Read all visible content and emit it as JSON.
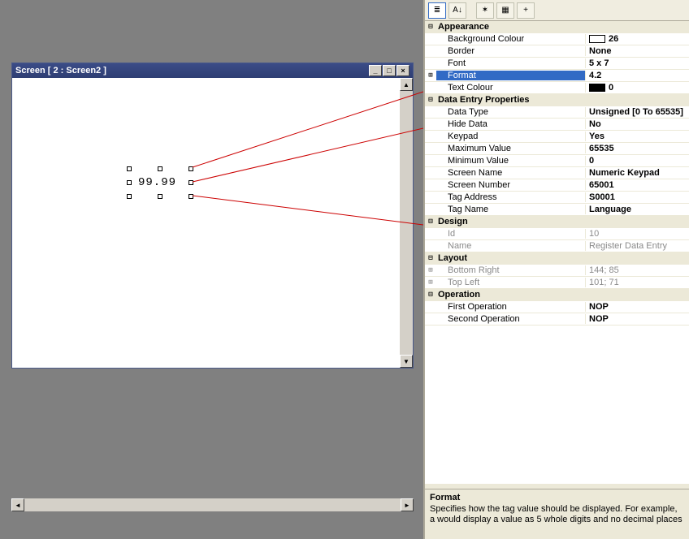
{
  "window": {
    "title": "Screen  [ 2 : Screen2 ]",
    "field_value": "99.99"
  },
  "toolbar": {
    "btn1": "≣",
    "btn2": "A↓",
    "btn3": "✶",
    "btn4": "▦",
    "btn5": "+"
  },
  "props": {
    "appearance": {
      "label": "Appearance",
      "bg_colour_label": "Background Colour",
      "bg_colour_value": "26",
      "border_label": "Border",
      "border_value": "None",
      "font_label": "Font",
      "font_value": "5 x 7",
      "format_label": "Format",
      "format_value": "4.2",
      "text_colour_label": "Text Colour",
      "text_colour_value": "0"
    },
    "data_entry": {
      "label": "Data Entry Properties",
      "data_type_label": "Data Type",
      "data_type_value": "Unsigned [0 To 65535]",
      "hide_data_label": "Hide Data",
      "hide_data_value": "No",
      "keypad_label": "Keypad",
      "keypad_value": "Yes",
      "max_label": "Maximum Value",
      "max_value": "65535",
      "min_label": "Minimum Value",
      "min_value": "0",
      "screen_name_label": "Screen Name",
      "screen_name_value": "Numeric Keypad",
      "screen_number_label": "Screen Number",
      "screen_number_value": "65001",
      "tag_address_label": "Tag Address",
      "tag_address_value": "S0001",
      "tag_name_label": "Tag Name",
      "tag_name_value": "Language"
    },
    "design": {
      "label": "Design",
      "id_label": "Id",
      "id_value": "10",
      "name_label": "Name",
      "name_value": "Register Data Entry"
    },
    "layout": {
      "label": "Layout",
      "br_label": "Bottom Right",
      "br_value": "144; 85",
      "tl_label": "Top Left",
      "tl_value": "101; 71"
    },
    "operation": {
      "label": "Operation",
      "first_label": "First Operation",
      "first_value": "NOP",
      "second_label": "Second Operation",
      "second_value": "NOP"
    }
  },
  "description": {
    "title": "Format",
    "body": "Specifies how the tag value should be displayed. For example, a  would display a value as 5 whole digits and no decimal places "
  }
}
